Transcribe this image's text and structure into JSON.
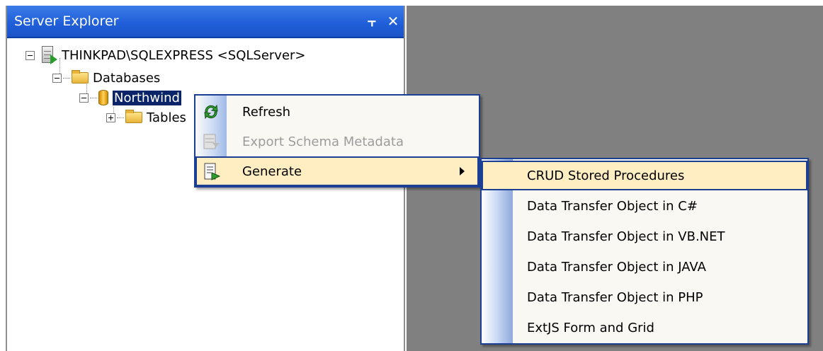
{
  "panel": {
    "title": "Server Explorer",
    "pin_glyph": "⫟",
    "close_glyph": "✕"
  },
  "tree": {
    "server": "THINKPAD\\SQLEXPRESS <SQLServer>",
    "databases": "Databases",
    "northwind": "Northwind",
    "tables": "Tables"
  },
  "context_menu": {
    "items": [
      {
        "label": "Refresh",
        "icon": "refresh-icon",
        "enabled": true
      },
      {
        "label": "Export Schema Metadata",
        "icon": "export-schema-icon",
        "enabled": false
      },
      {
        "label": "Generate",
        "icon": "generate-icon",
        "enabled": true,
        "submenu": true
      }
    ]
  },
  "submenu": {
    "items": [
      {
        "label": "CRUD Stored Procedures"
      },
      {
        "label": "Data Transfer Object in C#"
      },
      {
        "label": "Data Transfer Object in VB.NET"
      },
      {
        "label": "Data Transfer Object in JAVA"
      },
      {
        "label": "Data Transfer Object in PHP"
      },
      {
        "label": "ExtJS Form and Grid"
      }
    ]
  },
  "colors": {
    "titlebar": "#1f5ed8",
    "selection": "#0a246a",
    "menu_hover": "#ffeec2",
    "menu_border": "#1c3f94",
    "workspace": "#808080"
  }
}
